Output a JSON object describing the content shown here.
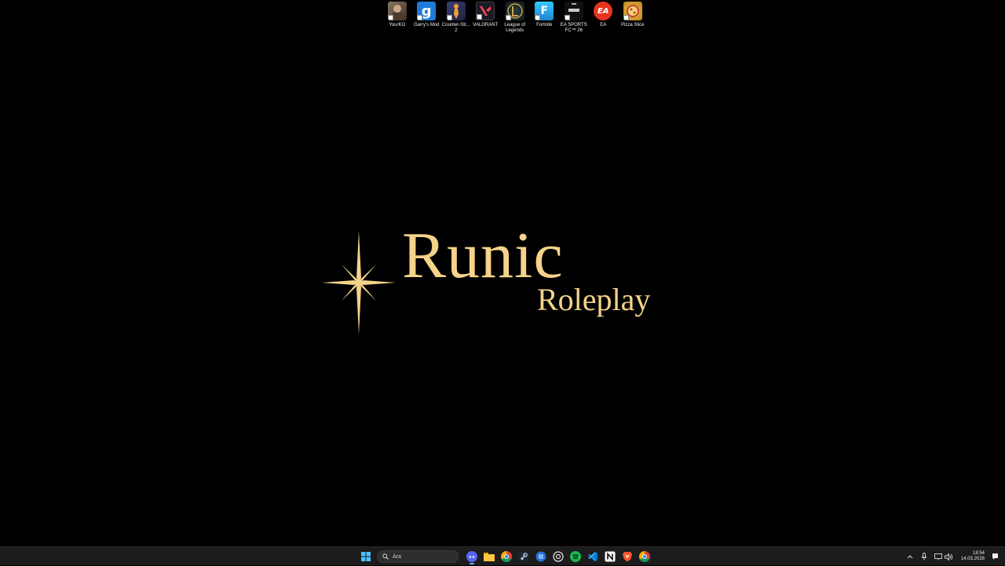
{
  "desktop": {
    "icons": [
      {
        "label": "YourKO",
        "icon": "yourko-icon",
        "color": "#6b5a4a"
      },
      {
        "label": "Garry's Mod",
        "icon": "garrys-mod-icon",
        "color": "#1f7ad8"
      },
      {
        "label": "Counter-Str... 2",
        "icon": "counter-strike-icon",
        "color": "#2a2f59"
      },
      {
        "label": "VALORANT",
        "icon": "valorant-icon",
        "color": "#1b1b24"
      },
      {
        "label": "League of Legends",
        "icon": "league-of-legends-icon",
        "color": "#c7a24a"
      },
      {
        "label": "Fortnite",
        "icon": "fortnite-icon",
        "color": "#2aa9e6"
      },
      {
        "label": "EA SPORTS FC™ 26",
        "icon": "ea-sports-fc-icon",
        "color": "#111111"
      },
      {
        "label": "EA",
        "icon": "ea-icon",
        "color": "#e6341e"
      },
      {
        "label": "Pizza Slice",
        "icon": "pizza-slice-icon",
        "color": "#d9a62a"
      }
    ]
  },
  "wallpaper": {
    "title": "Runic",
    "subtitle": "Roleplay",
    "accent": "#f5d389"
  },
  "taskbar": {
    "search_placeholder": "Ara",
    "apps": [
      "discord-icon",
      "file-explorer-icon",
      "chrome-icon",
      "steam-icon",
      "bluestacks-icon",
      "chatgpt-icon",
      "spotify-icon",
      "vscode-icon",
      "notion-icon",
      "brave-icon",
      "google-chrome-icon"
    ],
    "tray": {
      "time": "18:54",
      "date": "14.03.2026"
    }
  }
}
